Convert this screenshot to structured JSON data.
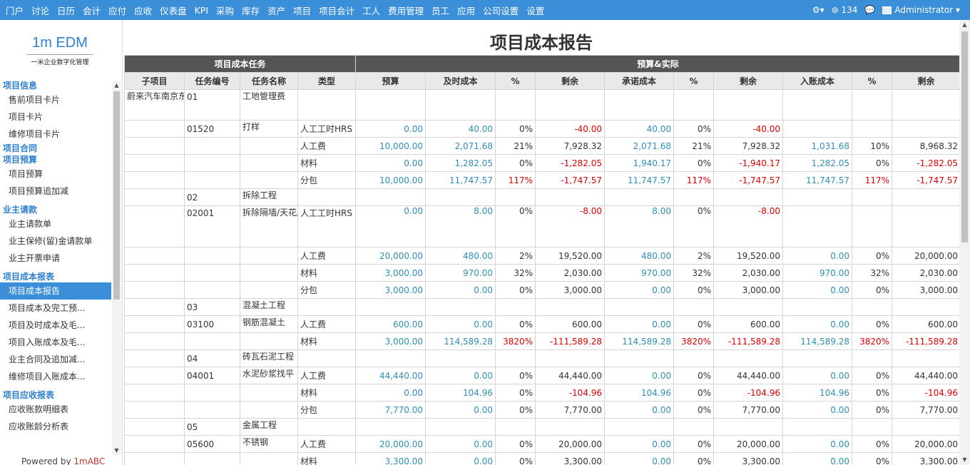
{
  "topbar": {
    "menu": [
      "门户",
      "讨论",
      "日历",
      "会计",
      "应付",
      "应收",
      "仪表盘",
      "KPI",
      "采购",
      "库存",
      "资产",
      "项目",
      "项目会计",
      "工人",
      "费用管理",
      "员工",
      "应用",
      "公司设置",
      "设置"
    ],
    "gear": "⚙▾",
    "notif_count": "134",
    "user": "Administrator ▾"
  },
  "sidebar": {
    "logo_main": "1m EDM",
    "logo_sub": "一米企业数字化管理",
    "sections": [
      {
        "title": "项目信息",
        "items": [
          "售前项目卡片",
          "项目卡片",
          "维修项目卡片"
        ]
      },
      {
        "title": "项目合同",
        "items": []
      },
      {
        "title": "项目预算",
        "items": [
          "项目预算",
          "项目预算追加减"
        ]
      },
      {
        "title": "业主请款",
        "items": [
          "业主请款单",
          "业主保修(留)金请款单",
          "业主开票申请"
        ]
      },
      {
        "title": "项目成本报表",
        "items": [
          "项目成本报告",
          "项目成本及完工预...",
          "项目及时成本及毛...",
          "项目入账成本及毛...",
          "业主合同及追加减...",
          "维修项目入账成本..."
        ]
      },
      {
        "title": "项目应收报表",
        "items": [
          "应收账款明细表",
          "应收账龄分析表"
        ]
      }
    ],
    "active_item": "项目成本报告",
    "powered_prefix": "Powered by ",
    "powered_brand": "1mABC"
  },
  "report": {
    "title": "项目成本报告",
    "group_headers": [
      "项目成本任务",
      "预算&实际"
    ],
    "columns": [
      "子项目",
      "任务编号",
      "任务名称",
      "类型",
      "预算",
      "及时成本",
      "%",
      "剩余",
      "承诺成本",
      "%",
      "剩余",
      "入账成本",
      "%",
      "剩余"
    ],
    "rows": [
      {
        "c": [
          "蔚来汽车南京东路店装修",
          "01",
          "工地管理费",
          "",
          "",
          "",
          "",
          "",
          "",
          "",
          "",
          "",
          "",
          ""
        ],
        "tall": true
      },
      {
        "c": [
          "",
          "01520",
          "打样",
          "人工工时HRS",
          "0.00",
          "40.00",
          "0%",
          "-40.00",
          "40.00",
          "0%",
          "-40.00",
          "",
          "",
          ""
        ]
      },
      {
        "c": [
          "",
          "",
          "",
          "人工费",
          "10,000.00",
          "2,071.68",
          "21%",
          "7,928.32",
          "2,071.68",
          "21%",
          "7,928.32",
          "1,031.68",
          "10%",
          "8,968.32"
        ]
      },
      {
        "c": [
          "",
          "",
          "",
          "材料",
          "0.00",
          "1,282.05",
          "0%",
          "-1,282.05",
          "1,940.17",
          "0%",
          "-1,940.17",
          "1,282.05",
          "0%",
          "-1,282.05"
        ]
      },
      {
        "c": [
          "",
          "",
          "",
          "分包",
          "10,000.00",
          "11,747.57",
          "117%",
          "-1,747.57",
          "11,747.57",
          "117%",
          "-1,747.57",
          "11,747.57",
          "117%",
          "-1,747.57"
        ]
      },
      {
        "c": [
          "",
          "02",
          "拆除工程",
          "",
          "",
          "",
          "",
          "",
          "",
          "",
          "",
          "",
          "",
          ""
        ]
      },
      {
        "c": [
          "",
          "02001",
          "拆除隔墙/天花/地面/灯具等",
          "人工工时HRS",
          "0.00",
          "8.00",
          "0%",
          "-8.00",
          "8.00",
          "0%",
          "-8.00",
          "",
          "",
          ""
        ],
        "tall": true
      },
      {
        "c": [
          "",
          "",
          "",
          "人工费",
          "20,000.00",
          "480.00",
          "2%",
          "19,520.00",
          "480.00",
          "2%",
          "19,520.00",
          "0.00",
          "0%",
          "20,000.00"
        ]
      },
      {
        "c": [
          "",
          "",
          "",
          "材料",
          "3,000.00",
          "970.00",
          "32%",
          "2,030.00",
          "970.00",
          "32%",
          "2,030.00",
          "970.00",
          "32%",
          "2,030.00"
        ]
      },
      {
        "c": [
          "",
          "",
          "",
          "分包",
          "3,000.00",
          "0.00",
          "0%",
          "3,000.00",
          "0.00",
          "0%",
          "3,000.00",
          "0.00",
          "0%",
          "3,000.00"
        ]
      },
      {
        "c": [
          "",
          "03",
          "混凝土工程",
          "",
          "",
          "",
          "",
          "",
          "",
          "",
          "",
          "",
          "",
          ""
        ]
      },
      {
        "c": [
          "",
          "03100",
          "钢筋混凝土",
          "人工费",
          "600.00",
          "0.00",
          "0%",
          "600.00",
          "0.00",
          "0%",
          "600.00",
          "0.00",
          "0%",
          "600.00"
        ]
      },
      {
        "c": [
          "",
          "",
          "",
          "材料",
          "3,000.00",
          "114,589.28",
          "3820%",
          "-111,589.28",
          "114,589.28",
          "3820%",
          "-111,589.28",
          "114,589.28",
          "3820%",
          "-111,589.28"
        ]
      },
      {
        "c": [
          "",
          "04",
          "砖瓦石泥工程",
          "",
          "",
          "",
          "",
          "",
          "",
          "",
          "",
          "",
          "",
          ""
        ]
      },
      {
        "c": [
          "",
          "04001",
          "水泥砂浆找平",
          "人工费",
          "44,440.00",
          "0.00",
          "0%",
          "44,440.00",
          "0.00",
          "0%",
          "44,440.00",
          "0.00",
          "0%",
          "44,440.00"
        ]
      },
      {
        "c": [
          "",
          "",
          "",
          "材料",
          "0.00",
          "104.96",
          "0%",
          "-104.96",
          "104.96",
          "0%",
          "-104.96",
          "104.96",
          "0%",
          "-104.96"
        ]
      },
      {
        "c": [
          "",
          "",
          "",
          "分包",
          "7,770.00",
          "0.00",
          "0%",
          "7,770.00",
          "0.00",
          "0%",
          "7,770.00",
          "0.00",
          "0%",
          "7,770.00"
        ]
      },
      {
        "c": [
          "",
          "05",
          "金属工程",
          "",
          "",
          "",
          "",
          "",
          "",
          "",
          "",
          "",
          "",
          ""
        ]
      },
      {
        "c": [
          "",
          "05600",
          "不锈钢",
          "人工费",
          "20,000.00",
          "0.00",
          "0%",
          "20,000.00",
          "0.00",
          "0%",
          "20,000.00",
          "0.00",
          "0%",
          "20,000.00"
        ]
      },
      {
        "c": [
          "",
          "",
          "",
          "材料",
          "3,300.00",
          "0.00",
          "0%",
          "3,300.00",
          "0.00",
          "0%",
          "3,300.00",
          "0.00",
          "0%",
          "3,300.00"
        ]
      }
    ]
  },
  "colors": {
    "topbar": "#3b8fd9",
    "blue_value": "#2e8fb8",
    "negative": "#dd0000",
    "header_dark": "#555555"
  }
}
